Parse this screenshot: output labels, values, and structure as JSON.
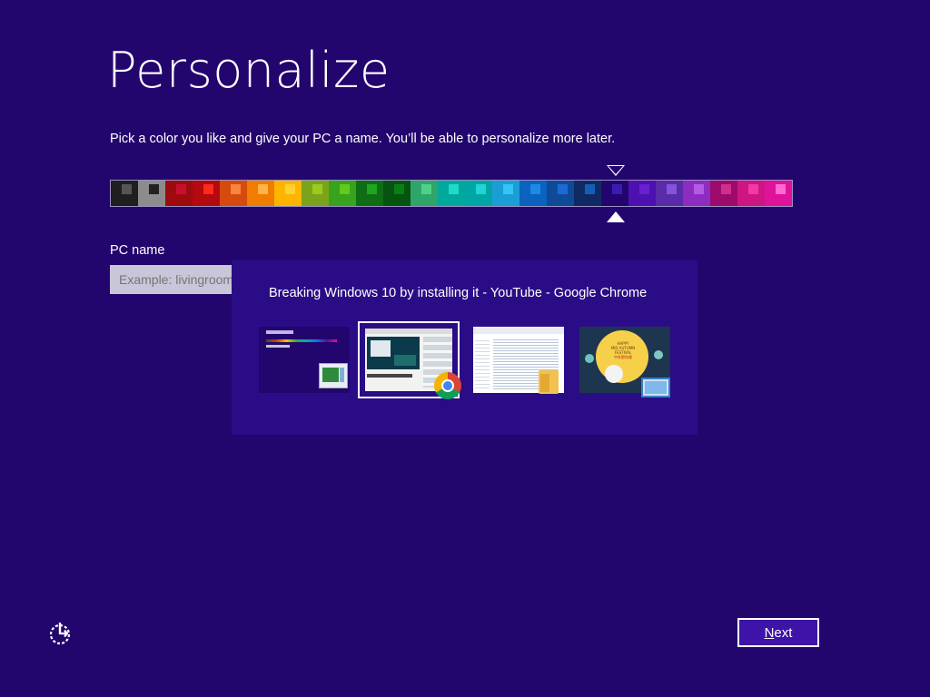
{
  "page": {
    "title": "Personalize",
    "subtitle": "Pick a color you like and give your PC a name. You’ll be able to personalize more later."
  },
  "colors": {
    "background": "#23066d",
    "switcher_bg": "#2a0d86",
    "next_button_bg": "#3d13a8",
    "palette": [
      {
        "bg": "#1f1f1f",
        "chip": "#555555"
      },
      {
        "bg": "#8c8c8c",
        "chip": "#222222"
      },
      {
        "bg": "#9e0b0f",
        "chip": "#c8102e"
      },
      {
        "bg": "#b4090f",
        "chip": "#ff2a1a"
      },
      {
        "bg": "#d64a10",
        "chip": "#f7853b"
      },
      {
        "bg": "#f07c00",
        "chip": "#ffb44a"
      },
      {
        "bg": "#ffb400",
        "chip": "#ffd232"
      },
      {
        "bg": "#7aa41c",
        "chip": "#9ccb1c"
      },
      {
        "bg": "#38a31c",
        "chip": "#62c91e"
      },
      {
        "bg": "#0f6e15",
        "chip": "#1fa51f"
      },
      {
        "bg": "#05540f",
        "chip": "#0b7f14"
      },
      {
        "bg": "#2fa56b",
        "chip": "#4fd18a"
      },
      {
        "bg": "#00a89d",
        "chip": "#1fdac8"
      },
      {
        "bg": "#00a5a6",
        "chip": "#22d4d4"
      },
      {
        "bg": "#1b9ed5",
        "chip": "#35c5f2"
      },
      {
        "bg": "#0b62bf",
        "chip": "#1e88e5"
      },
      {
        "bg": "#0f4a99",
        "chip": "#1b6ad8"
      },
      {
        "bg": "#0f2a63",
        "chip": "#135fb6"
      },
      {
        "bg": "#23066d",
        "chip": "#3b1cb3"
      },
      {
        "bg": "#4c11b0",
        "chip": "#6a1fd1"
      },
      {
        "bg": "#5a2ba8",
        "chip": "#8552db"
      },
      {
        "bg": "#8d2cc1",
        "chip": "#b25be4"
      },
      {
        "bg": "#9c0b6c",
        "chip": "#cf2e8a"
      },
      {
        "bg": "#cf1582",
        "chip": "#f23aa2"
      },
      {
        "bg": "#e0129b",
        "chip": "#ff6ad1"
      }
    ]
  },
  "pc_name": {
    "label": "PC name",
    "placeholder": "Example: livingroom-pc",
    "value": ""
  },
  "switcher": {
    "window_title": "Breaking Windows 10 by installing it - YouTube - Google Chrome",
    "thumbnails": [
      {
        "name": "personalize-setup",
        "icon": "setup-icon"
      },
      {
        "name": "chrome-youtube",
        "icon": "chrome-icon",
        "selected": true
      },
      {
        "name": "file-explorer",
        "icon": "folder-icon"
      },
      {
        "name": "festival-image",
        "icon": "computer-icon"
      }
    ],
    "festival_lines": [
      "HAPPY",
      "MID AUTUMN",
      "FESTIVAL",
      "中秋節快樂"
    ]
  },
  "buttons": {
    "next": "Next"
  },
  "icons": {
    "accessibility": "ease-of-access-icon"
  }
}
